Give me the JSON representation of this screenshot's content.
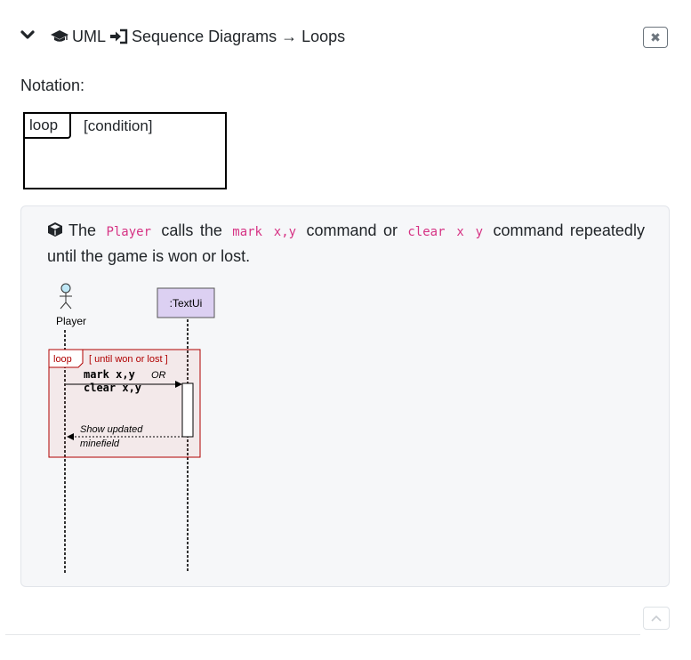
{
  "header": {
    "crumb_uml": "UML",
    "crumb_section": "Sequence Diagrams → Loops",
    "close_symbol": "✖"
  },
  "notation": {
    "label": "Notation:",
    "frame_keyword": "loop",
    "frame_condition": "[condition]"
  },
  "example": {
    "text_1": "The",
    "player_code": "Player",
    "text_2": "calls the",
    "mark_code": "mark x,y",
    "text_3": "command or",
    "clear_code": "clear x y",
    "text_4": "command repeatedly until the game is won or lost."
  },
  "diagram": {
    "actor_label": "Player",
    "object_label": ":TextUi",
    "loop_keyword": "loop",
    "loop_condition": "[ until won or lost ]",
    "msg_line1": "mark x,y",
    "msg_or": "OR",
    "msg_line2": "clear x,y",
    "return_line1": "Show updated",
    "return_line2": "minefield"
  },
  "colors": {
    "code_pink": "#d63384",
    "loop_red": "#b00000",
    "object_purple": "#dcd0f2",
    "actor_blue": "#bfe8f7"
  }
}
